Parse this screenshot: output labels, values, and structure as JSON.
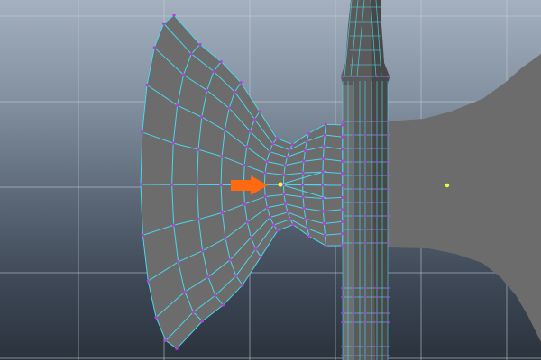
{
  "viewport": {
    "background_top": "#a4b0bf",
    "background_bottom": "#2a323d",
    "grid_color": "#c9d0d8",
    "mesh_face_color": "#6c6c6c",
    "mesh_edge_color": "#4ad7ea",
    "vertex_color": "#b040e0",
    "selected_vertex_color": "#e8ff3a",
    "handle_color": "#5a5a5a",
    "arrow_color": "#ff6a10"
  },
  "scene": {
    "objects": [
      "axe-blade-mesh",
      "axe-handle-mesh",
      "mirrored-blade"
    ],
    "annotation_icon": "arrow-right-icon"
  }
}
